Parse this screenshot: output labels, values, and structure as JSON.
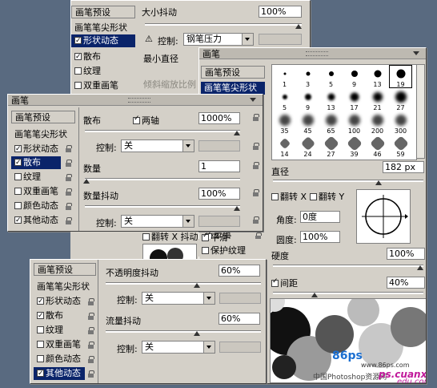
{
  "back_panel": {
    "title": "画笔",
    "sidebar": [
      {
        "label": "画笔预设",
        "checkbox": false,
        "header": true
      },
      {
        "label": "画笔笔尖形状",
        "checkbox": false,
        "header": false
      },
      {
        "label": "形状动态",
        "checkbox": true,
        "checked": true,
        "selected": true
      },
      {
        "label": "散布",
        "checkbox": true,
        "checked": true
      },
      {
        "label": "纹理",
        "checkbox": true,
        "checked": false
      },
      {
        "label": "双重画笔",
        "checkbox": true,
        "checked": false
      },
      {
        "label": "颜色动态",
        "checkbox": true,
        "checked": false
      },
      {
        "label": "其他动态",
        "checkbox": true,
        "checked": true
      }
    ],
    "size_jitter_label": "大小抖动",
    "size_jitter_value": "100%",
    "control_label": "控制:",
    "control_value": "钢笔压力",
    "min_diameter_label": "最小直径",
    "tilt_scale_label": "倾斜缩放比例",
    "flip_x_label": "翻转 X 抖动",
    "smoothing_label": "平滑",
    "protect_texture_label": "保护纹理"
  },
  "tip_panel": {
    "title": "画笔",
    "sidebar": [
      {
        "label": "画笔预设",
        "header": true
      },
      {
        "label": "画笔笔尖形状",
        "selected": true
      }
    ],
    "brush_sizes": [
      "1",
      "3",
      "5",
      "9",
      "13",
      "19",
      "5",
      "9",
      "13",
      "17",
      "21",
      "27",
      "35",
      "45",
      "65",
      "100",
      "200",
      "300",
      "14",
      "24",
      "27",
      "39",
      "46",
      "59"
    ],
    "diameter_label": "直径",
    "diameter_value": "182 px",
    "flip_x_label": "翻转 X",
    "flip_y_label": "翻转 Y",
    "angle_label": "角度:",
    "angle_value": "0度",
    "roundness_label": "圆度:",
    "roundness_value": "100%",
    "hardness_label": "硬度",
    "hardness_value": "100%",
    "spacing_label": "间距",
    "spacing_checked": true,
    "spacing_value": "40%",
    "watermark_1": "86ps",
    "watermark_2": "www.86ps.com",
    "watermark_3": "中国Photoshop资源网",
    "watermark_4": "ps.cuanxiu",
    "watermark_5": "edu.com"
  },
  "scatter_panel": {
    "title": "画笔",
    "sidebar": [
      {
        "label": "画笔预设",
        "header": true
      },
      {
        "label": "画笔笔尖形状",
        "header": false
      },
      {
        "label": "形状动态",
        "checkbox": true,
        "checked": true
      },
      {
        "label": "散布",
        "checkbox": true,
        "checked": true,
        "selected": true
      },
      {
        "label": "纹理",
        "checkbox": true,
        "checked": false
      },
      {
        "label": "双重画笔",
        "checkbox": true,
        "checked": false
      },
      {
        "label": "颜色动态",
        "checkbox": true,
        "checked": false
      },
      {
        "label": "其他动态",
        "checkbox": true,
        "checked": true
      }
    ],
    "scatter_label": "散布",
    "both_axes_label": "两轴",
    "both_axes_checked": true,
    "scatter_value": "1000%",
    "control_label": "控制:",
    "control_value": "关",
    "count_label": "数量",
    "count_value": "1",
    "count_jitter_label": "数量抖动",
    "count_jitter_value": "100%",
    "control2_value": "关"
  },
  "other_panel": {
    "sidebar": [
      {
        "label": "画笔预设",
        "header": true
      },
      {
        "label": "画笔笔尖形状",
        "header": false
      },
      {
        "label": "形状动态",
        "checkbox": true,
        "checked": true
      },
      {
        "label": "散布",
        "checkbox": true,
        "checked": true
      },
      {
        "label": "纹理",
        "checkbox": true,
        "checked": false
      },
      {
        "label": "双重画笔",
        "checkbox": true,
        "checked": false
      },
      {
        "label": "颜色动态",
        "checkbox": true,
        "checked": false
      },
      {
        "label": "其他动态",
        "checkbox": true,
        "checked": true,
        "selected": true
      }
    ],
    "opacity_jitter_label": "不透明度抖动",
    "opacity_jitter_value": "60%",
    "control_label": "控制:",
    "control_value": "关",
    "flow_jitter_label": "流量抖动",
    "flow_jitter_value": "60%",
    "control2_value": "关"
  },
  "colors": {
    "selection": "#0a246a",
    "panel": "#d4d0c8",
    "desktop": "#596a80"
  }
}
